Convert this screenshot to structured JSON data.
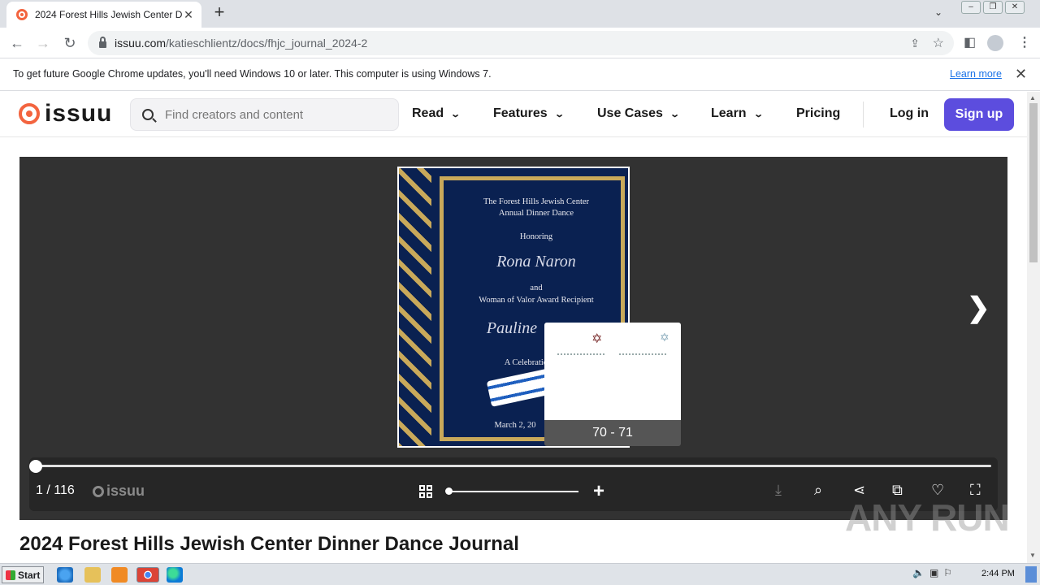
{
  "browser": {
    "tab_title": "2024 Forest Hills Jewish Center Dinn",
    "url_host": "issuu.com",
    "url_path": "/katieschlientz/docs/fhjc_journal_2024-2",
    "new_tab": "+",
    "tab_close": "✕"
  },
  "infobar": {
    "message": "To get future Google Chrome updates, you'll need Windows 10 or later. This computer is using Windows 7.",
    "learn_more": "Learn more"
  },
  "issuu_nav": {
    "logo": "issuu",
    "search_placeholder": "Find creators and content",
    "items": [
      {
        "label": "Read"
      },
      {
        "label": "Features"
      },
      {
        "label": "Use Cases"
      },
      {
        "label": "Learn"
      },
      {
        "label": "Pricing"
      }
    ],
    "login": "Log in",
    "signup": "Sign up"
  },
  "cover": {
    "line1": "The Forest Hills Jewish Center",
    "line2": "Annual Dinner Dance",
    "honoring": "Honoring",
    "name1": "Rona Naron",
    "and": "and",
    "award": "Woman of Valor Award Recipient",
    "name2": "Pauline",
    "celebration": "A Celebration",
    "date": "March 2, 20"
  },
  "thumb_preview": {
    "label": "70 - 71"
  },
  "viewer": {
    "page_indicator": "1 / 116",
    "brand": "issuu"
  },
  "document_title": "2024 Forest Hills Jewish Center Dinner Dance Journal",
  "watermark": "ANY RUN",
  "taskbar": {
    "start": "Start",
    "clock": "2:44 PM"
  },
  "colors": {
    "issuu_orange": "#f3643f",
    "signup_purple": "#5c4dde",
    "reader_bg": "#323232",
    "cover_navy": "#0a2151",
    "gold": "#c9a95a"
  }
}
